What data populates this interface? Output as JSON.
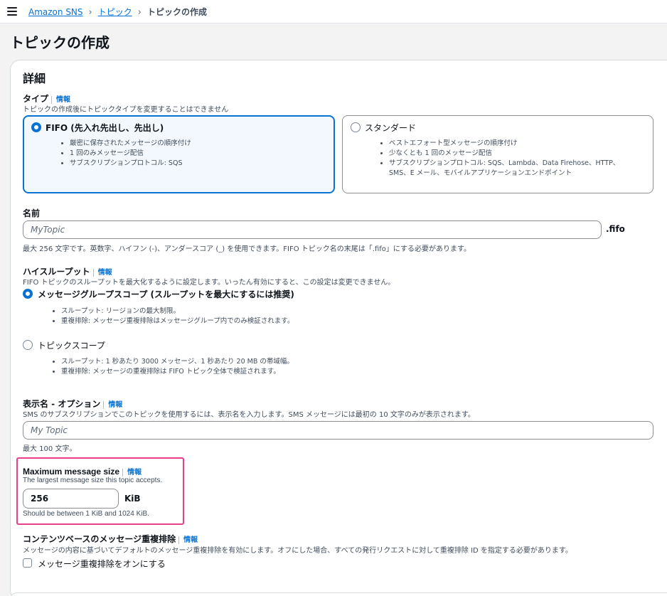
{
  "breadcrumb": {
    "service": "Amazon SNS",
    "topics": "トピック",
    "current": "トピックの作成"
  },
  "page_title": "トピックの作成",
  "details": {
    "title": "詳細",
    "type": {
      "label": "タイプ",
      "info": "情報",
      "description": "トピックの作成後にトピックタイプを変更することはできません",
      "fifo": {
        "label": "FIFO (先入れ先出し、先出し)",
        "selected": true,
        "bullets": [
          "厳密に保存されたメッセージの順序付け",
          "1 回のみメッセージ配信",
          "サブスクリプションプロトコル: SQS"
        ]
      },
      "standard": {
        "label": "スタンダード",
        "selected": false,
        "bullets": [
          "ベストエフォート型メッセージの順序付け",
          "少なくとも 1 回のメッセージ配信",
          "サブスクリプションプロトコル: SQS、Lambda、Data Firehose、HTTP、",
          "SMS、E メール、モバイルアプリケーションエンドポイント"
        ]
      }
    },
    "name": {
      "label": "名前",
      "placeholder": "MyTopic",
      "suffix": ".fifo",
      "hint": "最大 256 文字です。英数字、ハイフン (-)、アンダースコア (_) を使用できます。FIFO トピック名の末尾は「.fifo」にする必要があります。"
    },
    "throughput": {
      "label": "ハイスループット",
      "info": "情報",
      "description": "FIFO トピックのスループットを最大化するように設定します。いったん有効にすると、この設定は変更できません。",
      "group_scope": {
        "label": "メッセージグループスコープ (スループットを最大にするには推奨)",
        "selected": true,
        "bullets": [
          "スループット: リージョンの最大制限。",
          "重複排除: メッセージ重複排除はメッセージグループ内でのみ検証されます。"
        ]
      },
      "topic_scope": {
        "label": "トピックスコープ",
        "selected": false,
        "bullets": [
          "スループット: 1 秒あたり 3000 メッセージ、1 秒あたり 20 MB の帯域幅。",
          "重複排除: メッセージの重複排除は FIFO トピック全体で検証されます。"
        ]
      }
    },
    "display_name": {
      "label": "表示名 - オプション",
      "info": "情報",
      "description": "SMS のサブスクリプションでこのトピックを使用するには、表示名を入力します。SMS メッセージには最初の 10 文字のみが表示されます。",
      "placeholder": "My Topic",
      "hint": "最大 100 文字。"
    },
    "max_message_size": {
      "label": "Maximum message size",
      "info": "情報",
      "description": "The largest message size this topic accepts.",
      "value": "256",
      "unit": "KiB",
      "hint": "Should be between 1 KiB and 1024 KiB."
    },
    "content_dedup": {
      "label": "コンテンツベースのメッセージ重複排除",
      "info": "情報",
      "description": "メッセージの内容に基づいてデフォルトのメッセージ重複排除を有効にします。オフにした場合、すべての発行リクエストに対して重複排除 ID を指定する必要があります。",
      "checkbox_label": "メッセージ重複排除をオンにする",
      "checked": false
    }
  },
  "colors": {
    "accent": "#0972d3",
    "highlight": "#e83e8c"
  }
}
